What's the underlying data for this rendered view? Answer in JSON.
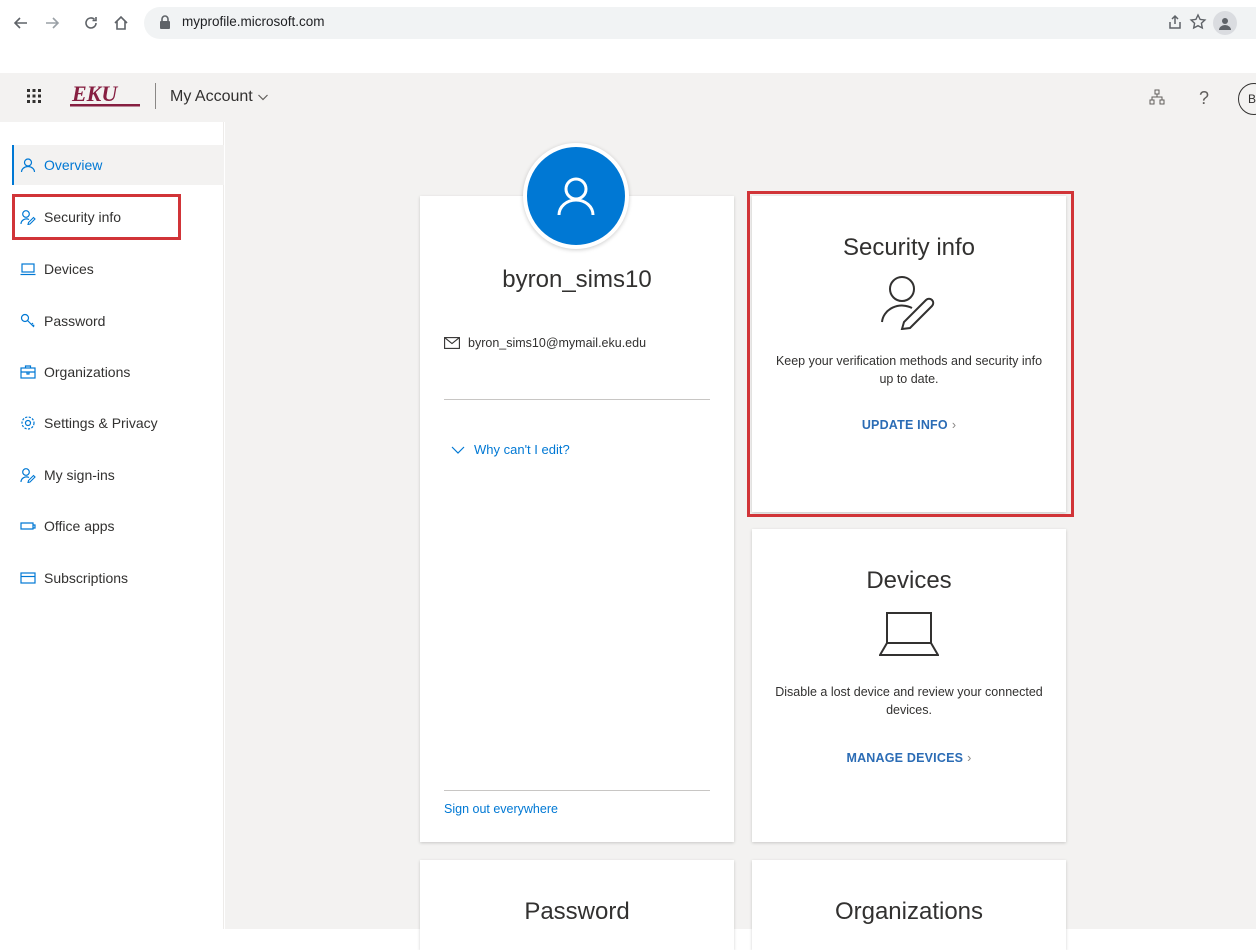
{
  "browser": {
    "url": "myprofile.microsoft.com"
  },
  "header": {
    "logo_text": "EKU",
    "title": "My Account",
    "avatar_initial": "B"
  },
  "sidebar": {
    "items": [
      {
        "label": "Overview",
        "icon": "person-icon",
        "active": true
      },
      {
        "label": "Security info",
        "icon": "person-pen-icon",
        "active": false
      },
      {
        "label": "Devices",
        "icon": "laptop-icon",
        "active": false
      },
      {
        "label": "Password",
        "icon": "key-icon",
        "active": false
      },
      {
        "label": "Organizations",
        "icon": "briefcase-icon",
        "active": false
      },
      {
        "label": "Settings & Privacy",
        "icon": "gear-icon",
        "active": false
      },
      {
        "label": "My sign-ins",
        "icon": "person-pen-icon",
        "active": false
      },
      {
        "label": "Office apps",
        "icon": "office-icon",
        "active": false
      },
      {
        "label": "Subscriptions",
        "icon": "card-icon",
        "active": false
      }
    ]
  },
  "profile": {
    "name": "byron_sims10",
    "email": "byron_sims10@mymail.eku.edu",
    "why_edit": "Why can't I edit?",
    "sign_out": "Sign out everywhere"
  },
  "cards": {
    "security": {
      "title": "Security info",
      "description": "Keep your verification methods and security info up to date.",
      "link": "UPDATE INFO"
    },
    "devices": {
      "title": "Devices",
      "description": "Disable a lost device and review your connected devices.",
      "link": "MANAGE DEVICES"
    },
    "password": {
      "title": "Password"
    },
    "organizations": {
      "title": "Organizations"
    }
  },
  "colors": {
    "accent": "#0078d4",
    "highlight": "#d13438",
    "link": "#2b6cb5"
  }
}
